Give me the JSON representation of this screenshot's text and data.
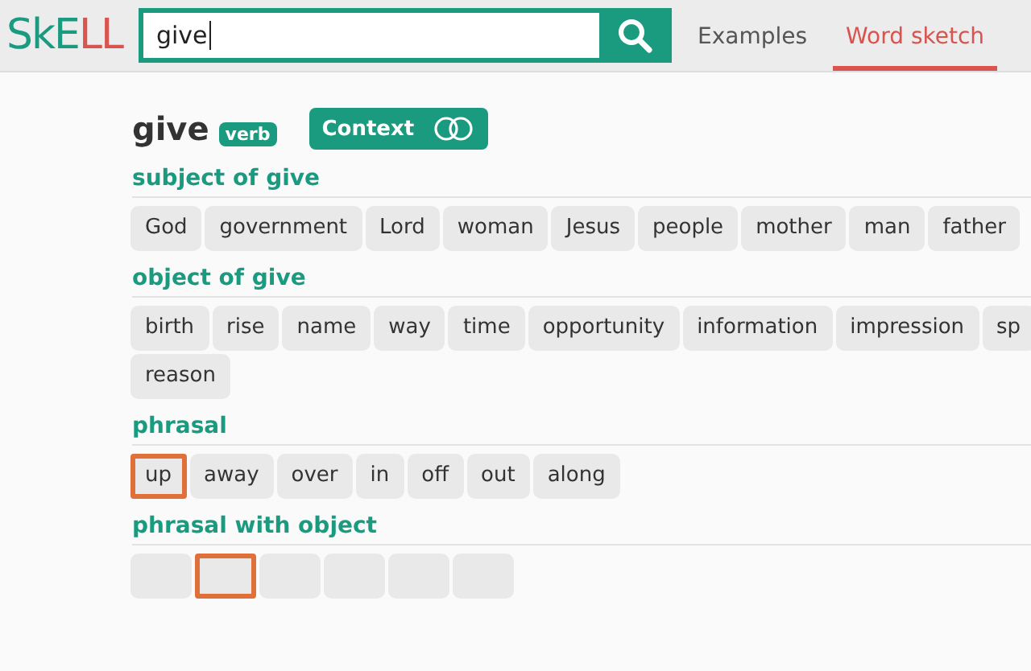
{
  "logo": {
    "parts": [
      {
        "text": "SkE",
        "kind": "plain"
      },
      {
        "text": "LL",
        "kind": "accent"
      }
    ]
  },
  "search": {
    "value": "give"
  },
  "tabs": [
    {
      "label": "Examples",
      "selected": false
    },
    {
      "label": "Word sketch",
      "selected": true
    }
  ],
  "headword": {
    "word": "give",
    "pos": "verb"
  },
  "context_toggle": {
    "label": "Context",
    "on": false
  },
  "sections": [
    {
      "title": "subject of give",
      "lines": [
        [
          {
            "text": "God",
            "highlighted": false
          },
          {
            "text": "government",
            "highlighted": false
          },
          {
            "text": "Lord",
            "highlighted": false
          },
          {
            "text": "woman",
            "highlighted": false
          },
          {
            "text": "Jesus",
            "highlighted": false
          },
          {
            "text": "people",
            "highlighted": false
          },
          {
            "text": "mother",
            "highlighted": false
          },
          {
            "text": "man",
            "highlighted": false
          },
          {
            "text": "father",
            "highlighted": false
          }
        ]
      ]
    },
    {
      "title": "object of give",
      "lines": [
        [
          {
            "text": "birth",
            "highlighted": false
          },
          {
            "text": "rise",
            "highlighted": false
          },
          {
            "text": "name",
            "highlighted": false
          },
          {
            "text": "way",
            "highlighted": false
          },
          {
            "text": "time",
            "highlighted": false
          },
          {
            "text": "opportunity",
            "highlighted": false
          },
          {
            "text": "information",
            "highlighted": false
          },
          {
            "text": "impression",
            "highlighted": false
          },
          {
            "text": "sp",
            "highlighted": false
          }
        ],
        [
          {
            "text": "reason",
            "highlighted": false
          }
        ]
      ]
    },
    {
      "title": "phrasal",
      "lines": [
        [
          {
            "text": "up",
            "highlighted": true
          },
          {
            "text": "away",
            "highlighted": false
          },
          {
            "text": "over",
            "highlighted": false
          },
          {
            "text": "in",
            "highlighted": false
          },
          {
            "text": "off",
            "highlighted": false
          },
          {
            "text": "out",
            "highlighted": false
          },
          {
            "text": "along",
            "highlighted": false
          }
        ]
      ]
    },
    {
      "title": "phrasal with object",
      "lines": [
        [
          {
            "highlighted": false
          },
          {
            "highlighted": true
          },
          {
            "highlighted": false
          },
          {
            "highlighted": false
          },
          {
            "highlighted": false
          },
          {
            "highlighted": false
          }
        ]
      ]
    }
  ]
}
